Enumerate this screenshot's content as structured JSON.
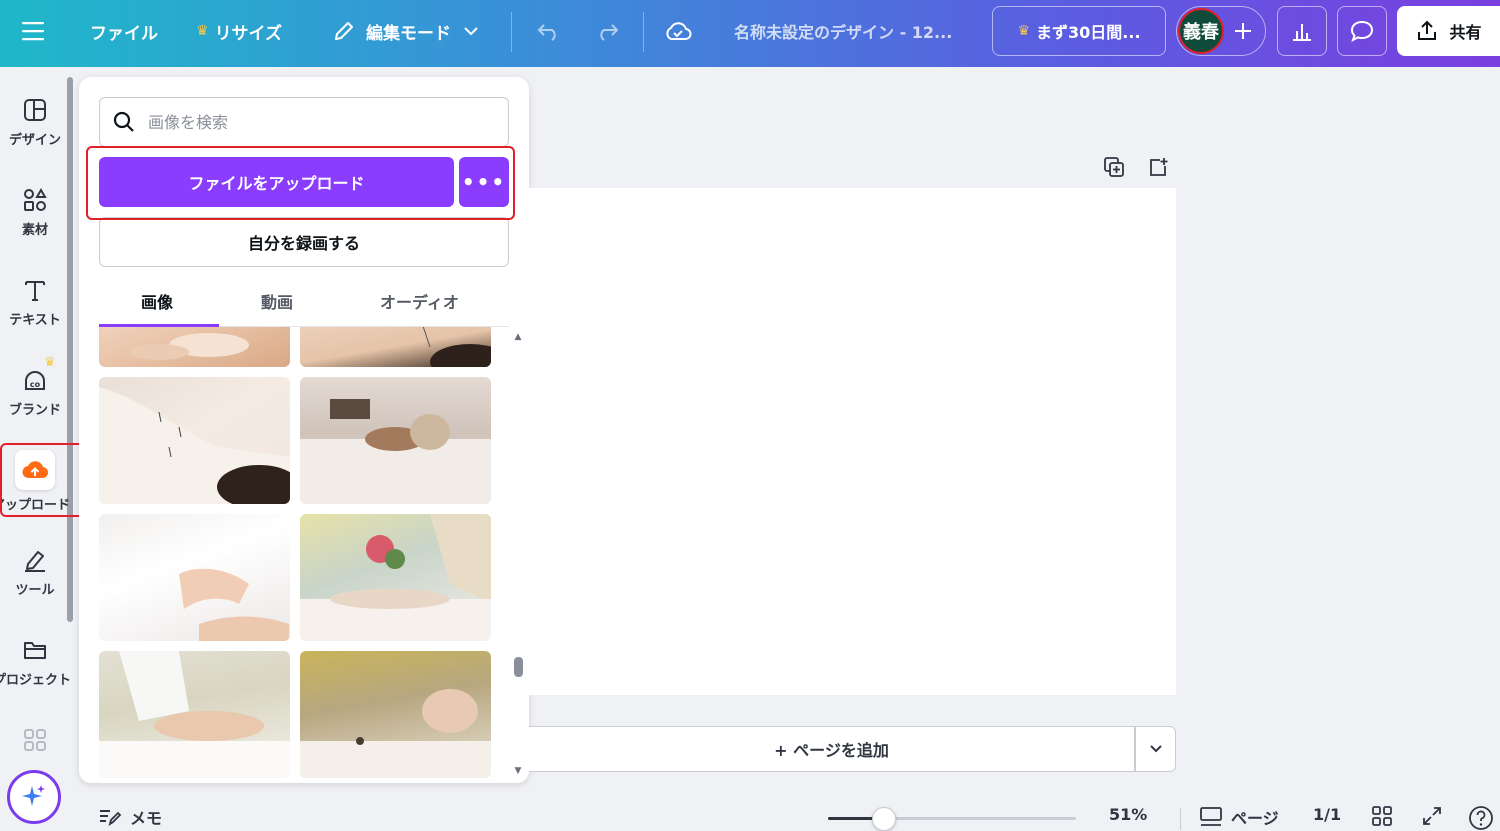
{
  "topbar": {
    "file": "ファイル",
    "resize": "リサイズ",
    "edit_mode": "編集モード",
    "doc_title": "名称未設定のデザイン - 12...",
    "trial": "まず30日間...",
    "avatar": "義春",
    "share": "共有"
  },
  "rail": {
    "items": [
      {
        "label": "デザイン",
        "icon": "layout-icon"
      },
      {
        "label": "素材",
        "icon": "elements-icon"
      },
      {
        "label": "テキスト",
        "icon": "text-icon"
      },
      {
        "label": "ブランド",
        "icon": "brand-icon"
      },
      {
        "label": "アップロード",
        "icon": "upload-cloud-icon"
      },
      {
        "label": "ツール",
        "icon": "pen-tool-icon"
      },
      {
        "label": "プロジェクト",
        "icon": "folder-icon"
      }
    ]
  },
  "panel": {
    "search_placeholder": "画像を検索",
    "upload_button": "ファイルをアップロード",
    "more_button": "•••",
    "record_button": "自分を録画する",
    "tabs": [
      "画像",
      "動画",
      "オーディオ"
    ],
    "active_tab": "画像",
    "images": [
      {
        "alt": "acupuncture-top-left"
      },
      {
        "alt": "acupuncture-top-right"
      },
      {
        "alt": "acupuncture-back"
      },
      {
        "alt": "spa-towel-room"
      },
      {
        "alt": "arm-massage"
      },
      {
        "alt": "treatment-window"
      },
      {
        "alt": "abdomen-treatment"
      },
      {
        "alt": "face-treatment"
      }
    ]
  },
  "canvas": {
    "add_page": "+ ページを追加"
  },
  "bottom": {
    "notes": "メモ",
    "zoom": "51%",
    "zoom_fraction": 0.51,
    "pages_label": "ページ",
    "page_count": "1/1"
  },
  "colors": {
    "accent": "#8b3dff",
    "highlight": "#e0202a",
    "crown": "#f7c948"
  }
}
